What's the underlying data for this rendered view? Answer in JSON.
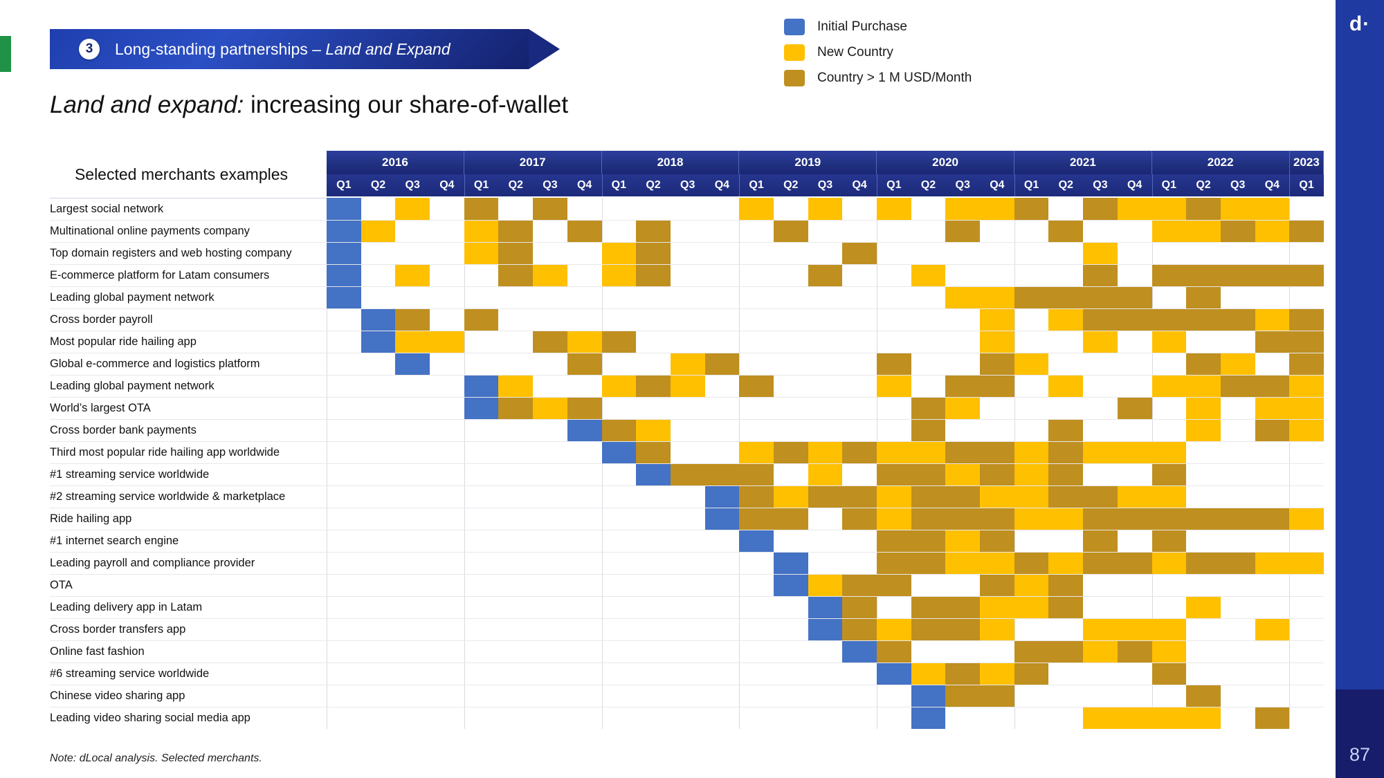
{
  "brand": {
    "logo": "d·",
    "page_number": "87"
  },
  "banner": {
    "number": "3",
    "text_plain": "Long-standing partnerships – ",
    "text_italic": "Land and Expand"
  },
  "headline": {
    "italic": "Land and expand:",
    "rest": " increasing our share-of-wallet"
  },
  "legend": {
    "items": [
      {
        "label": "Initial Purchase",
        "color": "#4472c4",
        "key": "b"
      },
      {
        "label": "New Country",
        "color": "#ffc000",
        "key": "y"
      },
      {
        "label": "Country > 1 M USD/Month",
        "color": "#bf8f1f",
        "key": "g"
      }
    ]
  },
  "note": "Note:  dLocal analysis. Selected merchants.",
  "chart_data": {
    "type": "heatmap",
    "title": "Land and expand: increasing our share-of-wallet",
    "row_header": "Selected merchants examples",
    "years": [
      {
        "label": "2016",
        "quarters": 4
      },
      {
        "label": "2017",
        "quarters": 4
      },
      {
        "label": "2018",
        "quarters": 4
      },
      {
        "label": "2019",
        "quarters": 4
      },
      {
        "label": "2020",
        "quarters": 4
      },
      {
        "label": "2021",
        "quarters": 4
      },
      {
        "label": "2022",
        "quarters": 4
      },
      {
        "label": "2023",
        "quarters": 1
      }
    ],
    "quarter_labels": [
      "Q1",
      "Q2",
      "Q3",
      "Q4",
      "Q1",
      "Q2",
      "Q3",
      "Q4",
      "Q1",
      "Q2",
      "Q3",
      "Q4",
      "Q1",
      "Q2",
      "Q3",
      "Q4",
      "Q1",
      "Q2",
      "Q3",
      "Q4",
      "Q1",
      "Q2",
      "Q3",
      "Q4",
      "Q1",
      "Q2",
      "Q3",
      "Q4",
      "Q1"
    ],
    "x": [
      "2016Q1",
      "2016Q2",
      "2016Q3",
      "2016Q4",
      "2017Q1",
      "2017Q2",
      "2017Q3",
      "2017Q4",
      "2018Q1",
      "2018Q2",
      "2018Q3",
      "2018Q4",
      "2019Q1",
      "2019Q2",
      "2019Q3",
      "2019Q4",
      "2020Q1",
      "2020Q2",
      "2020Q3",
      "2020Q4",
      "2021Q1",
      "2021Q2",
      "2021Q3",
      "2021Q4",
      "2022Q1",
      "2022Q2",
      "2022Q3",
      "2022Q4",
      "2023Q1"
    ],
    "value_legend": {
      "b": "Initial Purchase",
      "y": "New Country",
      "g": "Country > 1 M USD/Month",
      "": "none"
    },
    "rows": [
      {
        "label": "Largest social network",
        "values": [
          "b",
          "",
          "y",
          "",
          "g",
          "",
          "g",
          "",
          "",
          "",
          "",
          "",
          "y",
          "",
          "y",
          "",
          "y",
          "",
          "y",
          "y",
          "g",
          "",
          "g",
          "y",
          "y",
          "g",
          "y",
          "y",
          ""
        ]
      },
      {
        "label": "Multinational online payments company",
        "values": [
          "b",
          "y",
          "",
          "",
          "y",
          "g",
          "",
          "g",
          "",
          "g",
          "",
          "",
          "",
          "g",
          "",
          "",
          "",
          "",
          "g",
          "",
          "",
          "g",
          "",
          "",
          "y",
          "y",
          "g",
          "y",
          "g"
        ]
      },
      {
        "label": "Top domain registers and web hosting company",
        "values": [
          "b",
          "",
          "",
          "",
          "y",
          "g",
          "",
          "",
          "y",
          "g",
          "",
          "",
          "",
          "",
          "",
          "g",
          "",
          "",
          "",
          "",
          "",
          "",
          "y",
          "",
          "",
          "",
          "",
          "",
          ""
        ]
      },
      {
        "label": "E-commerce platform for Latam consumers",
        "values": [
          "b",
          "",
          "y",
          "",
          "",
          "g",
          "y",
          "",
          "y",
          "g",
          "",
          "",
          "",
          "",
          "g",
          "",
          "",
          "y",
          "",
          "",
          "",
          "",
          "g",
          "",
          "g",
          "g",
          "g",
          "g",
          "g"
        ]
      },
      {
        "label": "Leading global payment network",
        "values": [
          "b",
          "",
          "",
          "",
          "",
          "",
          "",
          "",
          "",
          "",
          "",
          "",
          "",
          "",
          "",
          "",
          "",
          "",
          "y",
          "y",
          "g",
          "g",
          "g",
          "g",
          "",
          "g",
          "",
          "",
          ""
        ]
      },
      {
        "label": "Cross border payroll",
        "values": [
          "",
          "b",
          "g",
          "",
          "g",
          "",
          "",
          "",
          "",
          "",
          "",
          "",
          "",
          "",
          "",
          "",
          "",
          "",
          "",
          "y",
          "",
          "y",
          "g",
          "g",
          "g",
          "g",
          "g",
          "y",
          "g"
        ]
      },
      {
        "label": "Most popular ride hailing app",
        "values": [
          "",
          "b",
          "y",
          "y",
          "",
          "",
          "g",
          "y",
          "g",
          "",
          "",
          "",
          "",
          "",
          "",
          "",
          "",
          "",
          "",
          "y",
          "",
          "",
          "y",
          "",
          "y",
          "",
          "",
          "g",
          "g"
        ]
      },
      {
        "label": "Global e-commerce and logistics platform",
        "values": [
          "",
          "",
          "b",
          "",
          "",
          "",
          "",
          "g",
          "",
          "",
          "y",
          "g",
          "",
          "",
          "",
          "",
          "g",
          "",
          "",
          "g",
          "y",
          "",
          "",
          "",
          "",
          "g",
          "y",
          "",
          "g"
        ]
      },
      {
        "label": "Leading global payment network",
        "values": [
          "",
          "",
          "",
          "",
          "b",
          "y",
          "",
          "",
          "y",
          "g",
          "y",
          "",
          "g",
          "",
          "",
          "",
          "y",
          "",
          "g",
          "g",
          "",
          "y",
          "",
          "",
          "y",
          "y",
          "g",
          "g",
          "y"
        ]
      },
      {
        "label": "World’s largest OTA",
        "values": [
          "",
          "",
          "",
          "",
          "b",
          "g",
          "y",
          "g",
          "",
          "",
          "",
          "",
          "",
          "",
          "",
          "",
          "",
          "g",
          "y",
          "",
          "",
          "",
          "",
          "g",
          "",
          "y",
          "",
          "y",
          "y"
        ]
      },
      {
        "label": "Cross border bank payments",
        "values": [
          "",
          "",
          "",
          "",
          "",
          "",
          "",
          "b",
          "g",
          "y",
          "",
          "",
          "",
          "",
          "",
          "",
          "",
          "g",
          "",
          "",
          "",
          "g",
          "",
          "",
          "",
          "y",
          "",
          "g",
          "y"
        ]
      },
      {
        "label": "Third most popular ride hailing app worldwide",
        "values": [
          "",
          "",
          "",
          "",
          "",
          "",
          "",
          "",
          "b",
          "g",
          "",
          "",
          "y",
          "g",
          "y",
          "g",
          "y",
          "y",
          "g",
          "g",
          "y",
          "g",
          "y",
          "y",
          "y",
          "",
          "",
          "",
          ""
        ]
      },
      {
        "label": "#1 streaming service worldwide",
        "values": [
          "",
          "",
          "",
          "",
          "",
          "",
          "",
          "",
          "",
          "b",
          "g",
          "g",
          "g",
          "",
          "y",
          "",
          "g",
          "g",
          "y",
          "g",
          "y",
          "g",
          "",
          "",
          "g",
          "",
          "",
          "",
          ""
        ]
      },
      {
        "label": "#2 streaming service worldwide & marketplace",
        "values": [
          "",
          "",
          "",
          "",
          "",
          "",
          "",
          "",
          "",
          "",
          "",
          "b",
          "g",
          "y",
          "g",
          "g",
          "y",
          "g",
          "g",
          "y",
          "y",
          "g",
          "g",
          "y",
          "y",
          "",
          "",
          "",
          ""
        ]
      },
      {
        "label": "Ride hailing app",
        "values": [
          "",
          "",
          "",
          "",
          "",
          "",
          "",
          "",
          "",
          "",
          "",
          "b",
          "g",
          "g",
          "",
          "g",
          "y",
          "g",
          "g",
          "g",
          "y",
          "y",
          "g",
          "g",
          "g",
          "g",
          "g",
          "g",
          "y"
        ]
      },
      {
        "label": "#1 internet search engine",
        "values": [
          "",
          "",
          "",
          "",
          "",
          "",
          "",
          "",
          "",
          "",
          "",
          "",
          "b",
          "",
          "",
          "",
          "g",
          "g",
          "y",
          "g",
          "",
          "",
          "g",
          "",
          "g",
          "",
          "",
          "",
          ""
        ]
      },
      {
        "label": "Leading payroll and compliance provider",
        "values": [
          "",
          "",
          "",
          "",
          "",
          "",
          "",
          "",
          "",
          "",
          "",
          "",
          "",
          "b",
          "",
          "",
          "g",
          "g",
          "y",
          "y",
          "g",
          "y",
          "g",
          "g",
          "y",
          "g",
          "g",
          "y",
          "y"
        ]
      },
      {
        "label": "OTA",
        "values": [
          "",
          "",
          "",
          "",
          "",
          "",
          "",
          "",
          "",
          "",
          "",
          "",
          "",
          "b",
          "y",
          "g",
          "g",
          "",
          "",
          "g",
          "y",
          "g",
          "",
          "",
          "",
          "",
          "",
          "",
          ""
        ]
      },
      {
        "label": "Leading delivery app in Latam",
        "values": [
          "",
          "",
          "",
          "",
          "",
          "",
          "",
          "",
          "",
          "",
          "",
          "",
          "",
          "",
          "b",
          "g",
          "",
          "g",
          "g",
          "y",
          "y",
          "g",
          "",
          "",
          "",
          "y",
          "",
          "",
          ""
        ]
      },
      {
        "label": "Cross border transfers app",
        "values": [
          "",
          "",
          "",
          "",
          "",
          "",
          "",
          "",
          "",
          "",
          "",
          "",
          "",
          "",
          "b",
          "g",
          "y",
          "g",
          "g",
          "y",
          "",
          "",
          "y",
          "y",
          "y",
          "",
          "",
          "y",
          ""
        ]
      },
      {
        "label": "Online fast fashion",
        "values": [
          "",
          "",
          "",
          "",
          "",
          "",
          "",
          "",
          "",
          "",
          "",
          "",
          "",
          "",
          "",
          "b",
          "g",
          "",
          "",
          "",
          "g",
          "g",
          "y",
          "g",
          "y",
          "",
          "",
          "",
          ""
        ]
      },
      {
        "label": "#6 streaming service worldwide",
        "values": [
          "",
          "",
          "",
          "",
          "",
          "",
          "",
          "",
          "",
          "",
          "",
          "",
          "",
          "",
          "",
          "",
          "b",
          "y",
          "g",
          "y",
          "g",
          "",
          "",
          "",
          "g",
          "",
          "",
          "",
          ""
        ]
      },
      {
        "label": "Chinese video sharing app",
        "values": [
          "",
          "",
          "",
          "",
          "",
          "",
          "",
          "",
          "",
          "",
          "",
          "",
          "",
          "",
          "",
          "",
          "",
          "b",
          "g",
          "g",
          "",
          "",
          "",
          "",
          "",
          "g",
          "",
          "",
          ""
        ]
      },
      {
        "label": "Leading video sharing social media app",
        "values": [
          "",
          "",
          "",
          "",
          "",
          "",
          "",
          "",
          "",
          "",
          "",
          "",
          "",
          "",
          "",
          "",
          "",
          "b",
          "",
          "",
          "",
          "",
          "y",
          "y",
          "y",
          "y",
          "",
          "g",
          ""
        ]
      }
    ]
  }
}
